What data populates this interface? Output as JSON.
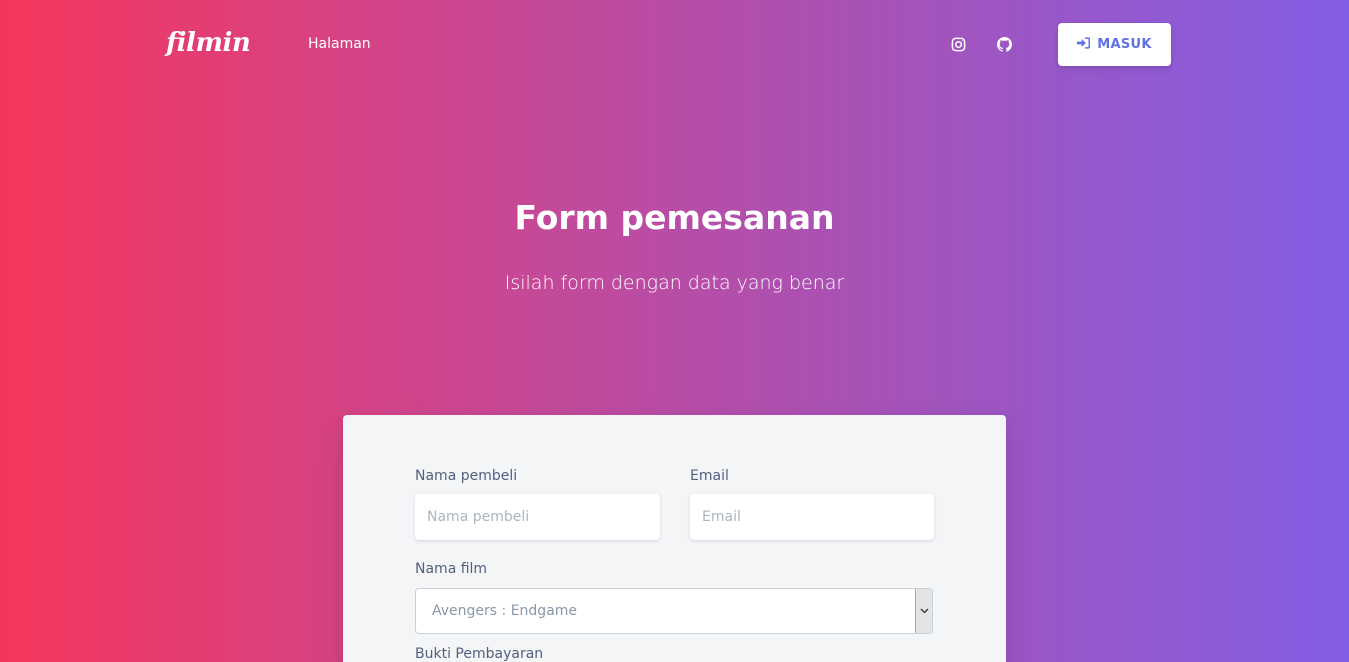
{
  "header": {
    "brand": "filmin",
    "nav_link": "Halaman",
    "icons": [
      "instagram-icon",
      "github-icon"
    ],
    "login_label": "MASUK",
    "login_icon": "sign-in-icon"
  },
  "hero": {
    "title": "Form pemesanan",
    "subtitle": "Isilah form dengan data yang benar"
  },
  "form": {
    "buyer_label": "Nama pembeli",
    "buyer_placeholder": "Nama pembeli",
    "email_label": "Email",
    "email_placeholder": "Email",
    "film_label": "Nama film",
    "film_selected": "Avengers : Endgame",
    "payment_label": "Bukti Pembayaran"
  },
  "colors": {
    "gradient_start": "#f5365c",
    "gradient_end": "#825ee4",
    "accent": "#5e72e4",
    "card_bg": "#f4f5f7"
  }
}
